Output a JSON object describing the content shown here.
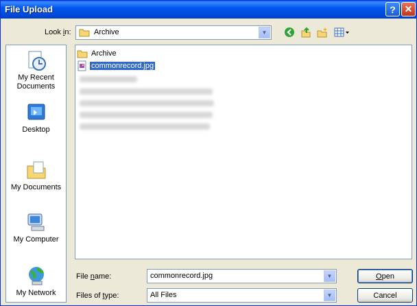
{
  "window": {
    "title": "File Upload",
    "help_glyph": "?",
    "close_glyph": "✕"
  },
  "lookin": {
    "label_pre": "Look ",
    "label_key": "i",
    "label_post": "n:",
    "value": "Archive"
  },
  "toolbar": {
    "icons": [
      "back-icon",
      "up-folder-icon",
      "new-folder-icon",
      "views-menu-icon"
    ]
  },
  "places": [
    {
      "label": "My Recent Documents",
      "icon": "recent-documents-icon"
    },
    {
      "label": "Desktop",
      "icon": "desktop-icon"
    },
    {
      "label": "My Documents",
      "icon": "my-documents-icon"
    },
    {
      "label": "My Computer",
      "icon": "my-computer-icon"
    },
    {
      "label": "My Network",
      "icon": "my-network-icon"
    }
  ],
  "files": [
    {
      "name": "Archive",
      "type": "folder",
      "selected": false
    },
    {
      "name": "commonrecord.jpg",
      "type": "image",
      "selected": true
    }
  ],
  "filename": {
    "label_pre": "File ",
    "label_key": "n",
    "label_post": "ame:",
    "value": "commonrecord.jpg"
  },
  "filetype": {
    "label_pre": "Files of ",
    "label_key": "t",
    "label_post": "ype:",
    "value": "All Files"
  },
  "buttons": {
    "open_key": "O",
    "open_rest": "pen",
    "cancel": "Cancel"
  },
  "colors": {
    "title_blue": "#0058ee",
    "selection": "#316ac5",
    "dialog_bg": "#ece9d8"
  }
}
